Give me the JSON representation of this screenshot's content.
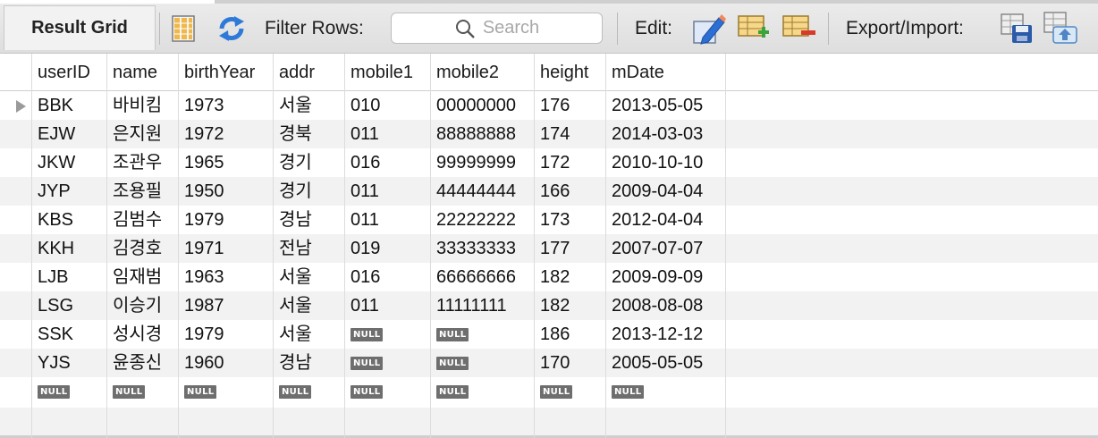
{
  "toolbar": {
    "result_grid_label": "Result Grid",
    "filter_label": "Filter Rows:",
    "search_placeholder": "Search",
    "edit_label": "Edit:",
    "export_label": "Export/Import:"
  },
  "grid": {
    "columns": [
      "userID",
      "name",
      "birthYear",
      "addr",
      "mobile1",
      "mobile2",
      "height",
      "mDate"
    ],
    "null_label": "NULL",
    "rows": [
      [
        "BBK",
        "바비킴",
        "1973",
        "서울",
        "010",
        "00000000",
        "176",
        "2013-05-05"
      ],
      [
        "EJW",
        "은지원",
        "1972",
        "경북",
        "011",
        "88888888",
        "174",
        "2014-03-03"
      ],
      [
        "JKW",
        "조관우",
        "1965",
        "경기",
        "016",
        "99999999",
        "172",
        "2010-10-10"
      ],
      [
        "JYP",
        "조용필",
        "1950",
        "경기",
        "011",
        "44444444",
        "166",
        "2009-04-04"
      ],
      [
        "KBS",
        "김범수",
        "1979",
        "경남",
        "011",
        "22222222",
        "173",
        "2012-04-04"
      ],
      [
        "KKH",
        "김경호",
        "1971",
        "전남",
        "019",
        "33333333",
        "177",
        "2007-07-07"
      ],
      [
        "LJB",
        "임재범",
        "1963",
        "서울",
        "016",
        "66666666",
        "182",
        "2009-09-09"
      ],
      [
        "LSG",
        "이승기",
        "1987",
        "서울",
        "011",
        "11111111",
        "182",
        "2008-08-08"
      ],
      [
        "SSK",
        "성시경",
        "1979",
        "서울",
        null,
        null,
        "186",
        "2013-12-12"
      ],
      [
        "YJS",
        "윤종신",
        "1960",
        "경남",
        null,
        null,
        "170",
        "2005-05-05"
      ],
      [
        null,
        null,
        null,
        null,
        null,
        null,
        null,
        null
      ]
    ]
  },
  "colors": {
    "null_badge": "#6e6e6e",
    "alt_row": "#f2f2f2",
    "edit_pencil": "#2b6fd6"
  }
}
